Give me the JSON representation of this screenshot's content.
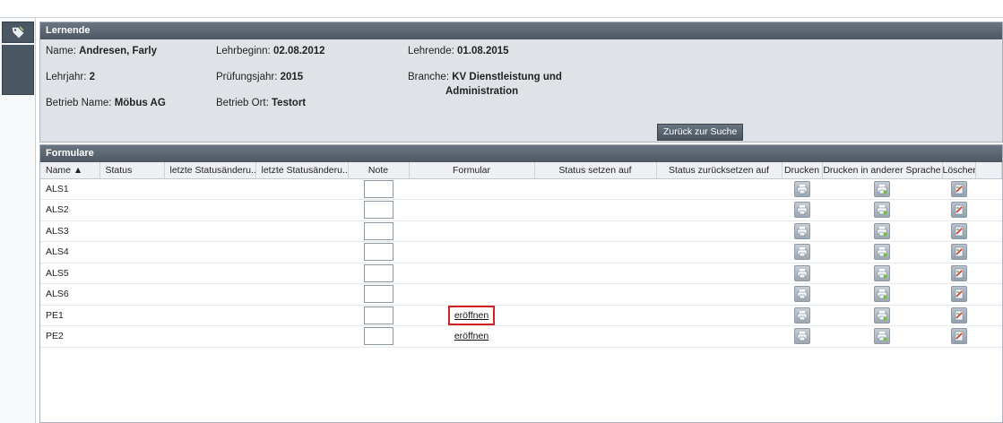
{
  "lernende": {
    "title": "Lernende",
    "name_label": "Name: ",
    "name_value": "Andresen, Farly",
    "lehrbeginn_label": "Lehrbeginn: ",
    "lehrbeginn_value": "02.08.2012",
    "lehrende_label": "Lehrende: ",
    "lehrende_value": "01.08.2015",
    "lehrjahr_label": "Lehrjahr: ",
    "lehrjahr_value": "2",
    "pruefungsjahr_label": "Prüfungsjahr: ",
    "pruefungsjahr_value": "2015",
    "branche_label": "Branche: ",
    "branche_value_line1": "KV Dienstleistung und",
    "branche_value_line2": "Administration",
    "betrieb_name_label": "Betrieb Name: ",
    "betrieb_name_value": "Möbus AG",
    "betrieb_ort_label": "Betrieb Ort: ",
    "betrieb_ort_value": "Testort",
    "back_button": "Zurück zur Suche"
  },
  "formulare": {
    "title": "Formulare",
    "columns": {
      "name": "Name ▲",
      "status": "Status",
      "letzte1": "letzte Statusänderu...",
      "letzte2": "letzte Statusänderu...",
      "note": "Note",
      "formular": "Formular",
      "status_setzen": "Status setzen auf",
      "status_zuruecksetzen": "Status zurücksetzen auf",
      "drucken": "Drucken",
      "drucken_sprache": "Drucken in anderer Sprache",
      "loeschen": "Löschen"
    },
    "rows": [
      {
        "name": "ALS1",
        "formular": ""
      },
      {
        "name": "ALS2",
        "formular": ""
      },
      {
        "name": "ALS3",
        "formular": ""
      },
      {
        "name": "ALS4",
        "formular": ""
      },
      {
        "name": "ALS5",
        "formular": ""
      },
      {
        "name": "ALS6",
        "formular": ""
      },
      {
        "name": "PE1",
        "formular": "eröffnen"
      },
      {
        "name": "PE2",
        "formular": "eröffnen"
      }
    ]
  },
  "icons": {
    "rail": "tag-edit-icon",
    "print": "printer-icon",
    "print_language": "printer-language-icon",
    "delete": "delete-form-icon"
  },
  "colors": {
    "header_bar": "#4e5864",
    "panel_bg": "#dfe3e8",
    "highlight": "#d42020"
  }
}
